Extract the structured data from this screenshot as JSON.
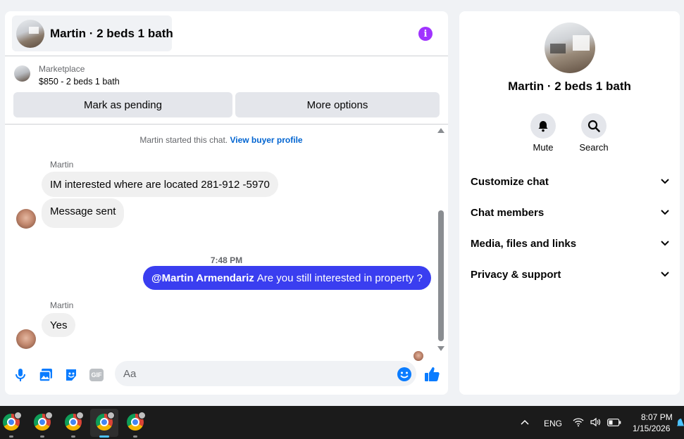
{
  "chat": {
    "header_title": "Martin · 2 beds 1 bath",
    "info_icon": "i",
    "listing": {
      "marketplace_label": "Marketplace",
      "price_title": "$850 - 2 beds 1 bath",
      "mark_pending_label": "Mark as pending",
      "more_options_label": "More options"
    },
    "started_text": "Martin started this chat.",
    "view_buyer_profile": "View buyer profile",
    "messages": [
      {
        "sender": "Martin",
        "text": "IM interested where are located 281-912 -5970"
      },
      {
        "text": "Message sent"
      },
      {
        "timestamp": "7:48 PM"
      },
      {
        "mention": "@Martin Armendariz",
        "text": "Are you still interested in property ?"
      },
      {
        "sender": "Martin",
        "text": "Yes"
      }
    ],
    "composer": {
      "placeholder": "Aa",
      "icons": [
        "microphone-icon",
        "photo-icon",
        "sticker-icon",
        "gif-icon",
        "emoji-icon",
        "thumbs-up-icon"
      ],
      "gif_label": "GIF"
    },
    "accent_color": "#3a3ef0"
  },
  "info_panel": {
    "name": "Martin · 2 beds 1 bath",
    "actions": [
      {
        "label": "Mute",
        "icon": "bell-icon"
      },
      {
        "label": "Search",
        "icon": "search-icon"
      }
    ],
    "sections": [
      "Customize chat",
      "Chat members",
      "Media, files and links",
      "Privacy & support"
    ]
  },
  "taskbar": {
    "language": "ENG",
    "time": "8:07 PM",
    "date": "1/15/2026"
  }
}
